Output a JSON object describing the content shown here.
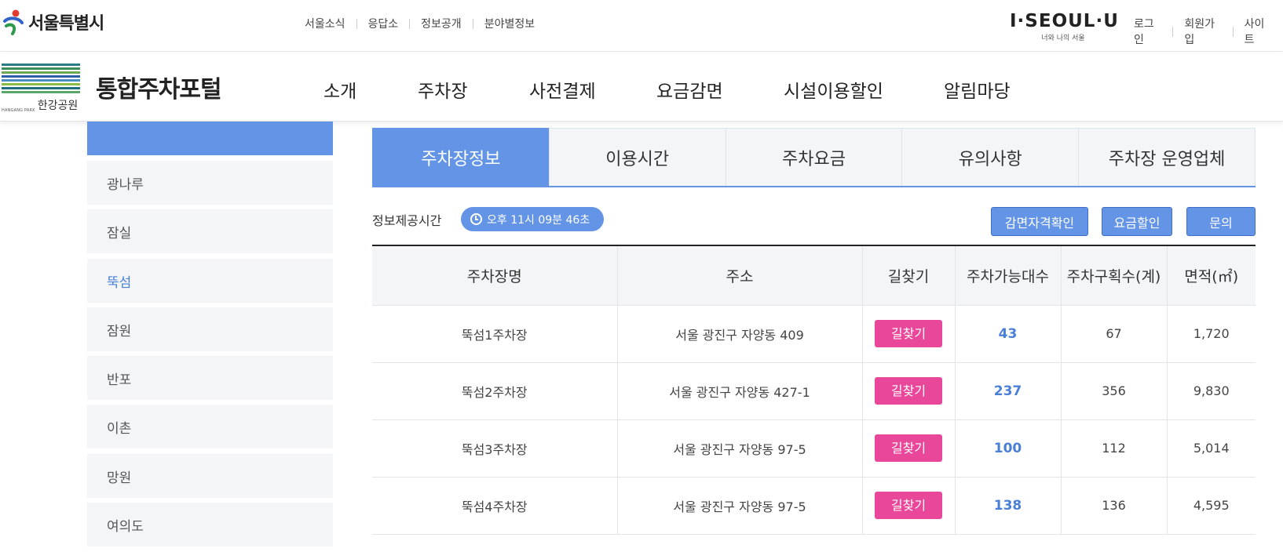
{
  "header": {
    "city_logo_text": "서울특별시",
    "top_links": [
      "서울소식",
      "응답소",
      "정보공개",
      "분야별정보"
    ],
    "brand": {
      "main": "I·SEOUL·U",
      "sub": "너와 나의 서울"
    },
    "account_links": [
      "로그인",
      "회원가입",
      "사이트"
    ]
  },
  "gnb": {
    "org_logo": {
      "en": "HANGANG PARK",
      "ko": "한강공원"
    },
    "portal_title": "통합주차포털",
    "menu": [
      "소개",
      "주차장",
      "사전결제",
      "요금감면",
      "시설이용할인",
      "알림마당"
    ]
  },
  "sidebar": {
    "items": [
      {
        "label": "광나루",
        "active": false
      },
      {
        "label": "잠실",
        "active": false
      },
      {
        "label": "뚝섬",
        "active": true
      },
      {
        "label": "잠원",
        "active": false
      },
      {
        "label": "반포",
        "active": false
      },
      {
        "label": "이촌",
        "active": false
      },
      {
        "label": "망원",
        "active": false
      },
      {
        "label": "여의도",
        "active": false
      }
    ]
  },
  "tabs": [
    {
      "label": "주차장정보",
      "active": true
    },
    {
      "label": "이용시간",
      "active": false
    },
    {
      "label": "주차요금",
      "active": false
    },
    {
      "label": "유의사항",
      "active": false
    },
    {
      "label": "주차장 운영업체",
      "active": false
    }
  ],
  "info": {
    "label": "정보제공시간",
    "time": "오후 11시 09분 46초"
  },
  "actions": {
    "eligibility": "감면자격확인",
    "discount": "요금할인",
    "inquiry": "문의"
  },
  "table": {
    "columns": [
      "주차장명",
      "주소",
      "길찾기",
      "주차가능대수",
      "주차구획수(계)",
      "면적(㎡)"
    ],
    "find_label": "길찾기",
    "rows": [
      {
        "name": "뚝섬1주차장",
        "address": "서울 광진구 자양동 409",
        "available": "43",
        "total": "67",
        "area": "1,720"
      },
      {
        "name": "뚝섬2주차장",
        "address": "서울 광진구 자양동 427-1",
        "available": "237",
        "total": "356",
        "area": "9,830"
      },
      {
        "name": "뚝섬3주차장",
        "address": "서울 광진구 자양동 97-5",
        "available": "100",
        "total": "112",
        "area": "5,014"
      },
      {
        "name": "뚝섬4주차장",
        "address": "서울 광진구 자양동 97-5",
        "available": "138",
        "total": "136",
        "area": "4,595"
      }
    ]
  },
  "colors": {
    "accent": "#6394e6",
    "find_button": "#e8479a",
    "available_text": "#4a7fd8"
  }
}
